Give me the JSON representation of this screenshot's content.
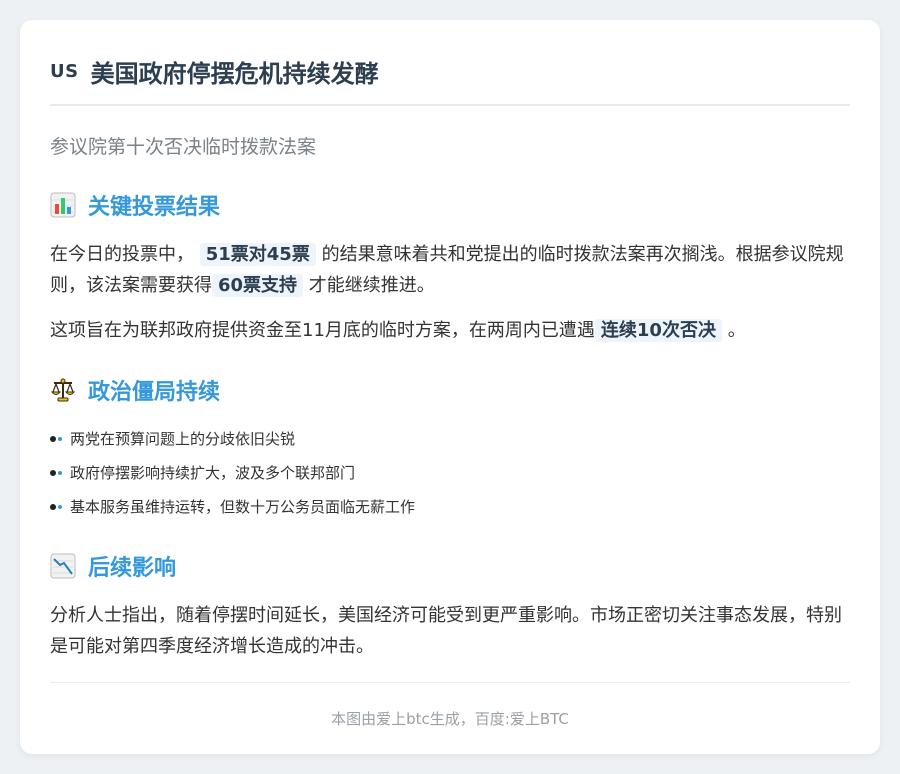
{
  "header": {
    "flag_text": "US",
    "title": "美国政府停摆危机持续发酵"
  },
  "subtitle": "参议院第十次否决临时拨款法案",
  "sections": {
    "vote": {
      "title": "关键投票结果",
      "icon": "bar-chart-icon",
      "p1_a": "在今日的投票中，",
      "p1_hl1": "51票对45票",
      "p1_b": "的结果意味着共和党提出的临时拨款法案再次搁浅。根据参议院规则，该法案需要获得",
      "p1_hl2": "60票支持",
      "p1_c": "才能继续推进。",
      "p2_a": "这项旨在为联邦政府提供资金至11月底的临时方案，在两周内已遭遇",
      "p2_hl": "连续10次否决",
      "p2_b": "。"
    },
    "deadlock": {
      "title": "政治僵局持续",
      "icon": "scales-icon",
      "items": [
        "两党在预算问题上的分歧依旧尖锐",
        "政府停摆影响持续扩大，波及多个联邦部门",
        "基本服务虽维持运转，但数十万公务员面临无薪工作"
      ]
    },
    "impact": {
      "title": "后续影响",
      "icon": "chart-decreasing-icon",
      "para": "分析人士指出，随着停摆时间延长，美国经济可能受到更严重影响。市场正密切关注事态发展，特别是可能对第四季度经济增长造成的冲击。"
    }
  },
  "footer": "本图由爱上btc生成，百度:爱上BTC",
  "colors": {
    "accent": "#3498db",
    "title": "#2c3e50",
    "highlight_bg": "#eef4fb"
  }
}
